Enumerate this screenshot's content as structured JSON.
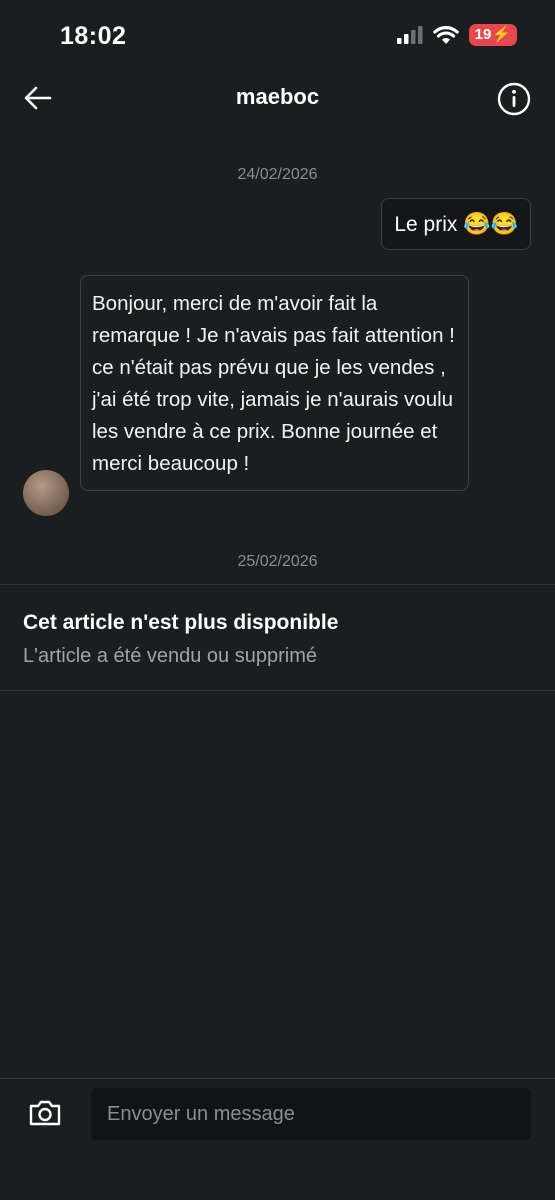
{
  "status_bar": {
    "time": "18:02",
    "battery": "19"
  },
  "header": {
    "title": "maeboc"
  },
  "messages": {
    "date1": "24/02/2026",
    "outgoing_text": "Le prix ",
    "outgoing_emoji": "😂😂",
    "incoming_text": "Bonjour, merci de m'avoir fait la remarque ! Je n'avais pas fait attention ! ce n'était pas prévu que je  les vendes , j'ai été trop vite, jamais je n'aurais voulu les vendre à ce prix. Bonne journée et merci beaucoup !",
    "date2": "25/02/2026"
  },
  "notice": {
    "title": "Cet article n'est plus disponible",
    "subtitle": "L'article a été vendu ou supprimé"
  },
  "composer": {
    "placeholder": "Envoyer un message"
  },
  "icons": {
    "back": "arrow-left-icon",
    "info": "info-icon",
    "camera": "camera-icon",
    "signal": "signal-icon",
    "wifi": "wifi-icon",
    "battery": "battery-charging-icon"
  }
}
